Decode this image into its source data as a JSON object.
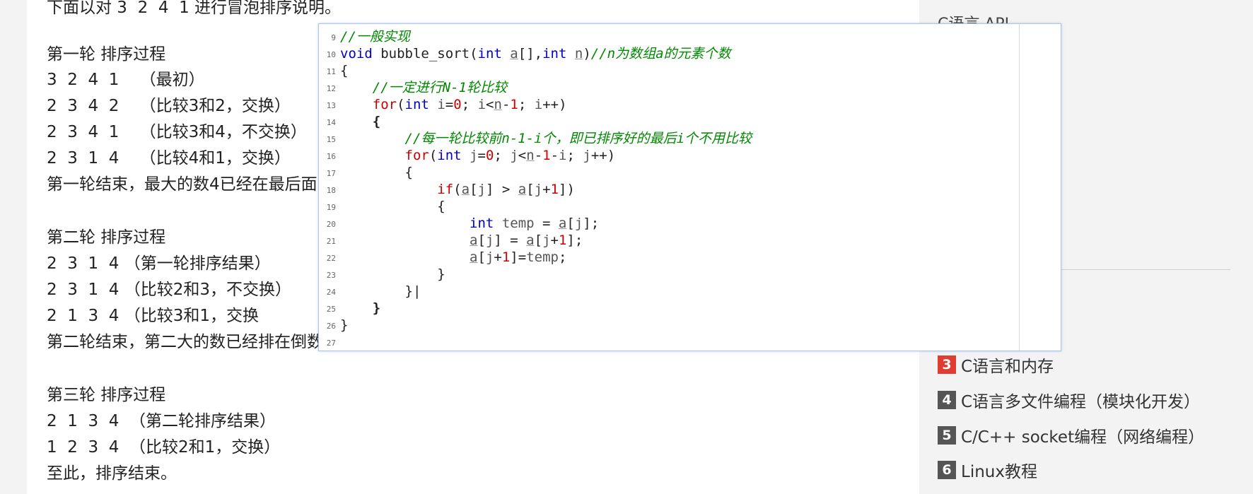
{
  "article": {
    "intro": "下面以对 3  2  4  1 进行冒泡排序说明。",
    "round1_title": "第一轮 排序过程",
    "round1_lines": [
      "3  2  4  1    （最初）",
      "2  3  4  2    （比较3和2，交换）",
      "2  3  4  1    （比较3和4，不交换）",
      "2  3  1  4    （比较4和1，交换）"
    ],
    "round1_end": "第一轮结束，最大的数4已经在最后面",
    "round2_title": "第二轮 排序过程",
    "round2_lines": [
      "2  3  1  4 （第一轮排序结果）",
      "2  3  1  4 （比较2和3，不交换）",
      "2  1  3  4 （比较3和1，交换"
    ],
    "round2_end": "第二轮结束，第二大的数已经排在倒数第二个位置，所以第三轮只需要比较前两个元素。",
    "round3_title": "第三轮 排序过程",
    "round3_lines": [
      "2  1  3  4  （第二轮排序结果）",
      "1  2  3  4  （比较2和1，交换）"
    ],
    "ending": "至此，排序结束。"
  },
  "sidebar": {
    "partial_heading": "C语言 API",
    "items": [
      {
        "num": "3",
        "label": "C语言和内存",
        "color": "#e03c31"
      },
      {
        "num": "4",
        "label": "C语言多文件编程（模块化开发）",
        "color": "#555555"
      },
      {
        "num": "5",
        "label": "C/C++ socket编程（网络编程）",
        "color": "#555555"
      },
      {
        "num": "6",
        "label": "Linux教程",
        "color": "#555555"
      }
    ]
  },
  "code_popup": {
    "line_numbers": [
      "9",
      "10",
      "11",
      "12",
      "13",
      "14",
      "15",
      "16",
      "17",
      "18",
      "19",
      "20",
      "21",
      "22",
      "23",
      "24",
      "25",
      "26",
      "27"
    ],
    "comment_general": "//一般实现",
    "comment_params": "//n为数组a的元素个数",
    "comment_rounds": "//一定进行N-1轮比较",
    "comment_inner": "//每一轮比较前n-1-i个，即已排序好的最后i个不用比较",
    "kw_void": "void",
    "kw_int": "int",
    "kw_for": "for",
    "kw_if": "if",
    "fn_name": "bubble_sort",
    "var_a": "a",
    "var_n": "n",
    "var_i": "i",
    "var_j": "j",
    "var_temp": "temp",
    "num_zero": "0",
    "num_one": "1"
  }
}
